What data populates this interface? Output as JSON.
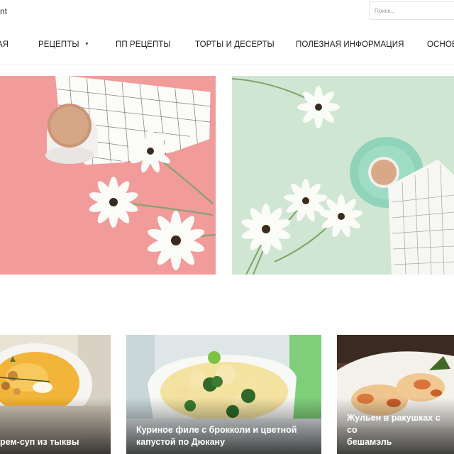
{
  "header": {
    "logo_text": "nt",
    "search_placeholder": "Поиск..."
  },
  "nav": {
    "items": [
      {
        "label": "АЯ"
      },
      {
        "label": "РЕЦЕПТЫ",
        "has_dropdown": true,
        "dropdown_icon": "chevron-down-icon"
      },
      {
        "label": "ПП РЕЦЕПТЫ"
      },
      {
        "label": "ТОРТЫ И ДЕСЕРТЫ"
      },
      {
        "label": "ПОЛЕЗНАЯ ИНФОРМАЦИЯ"
      },
      {
        "label": "ОСНОВ"
      }
    ]
  },
  "hero": {
    "left": {
      "image": "coffee-cup-and-daisies-on-pink",
      "bg_color": "#f19a9a"
    },
    "right": {
      "image": "coffee-cup-and-daisies-on-mint",
      "bg_color": "#cfe6d3"
    }
  },
  "cards": [
    {
      "title": "рем-суп из тыквы",
      "image": "pumpkin-cream-soup"
    },
    {
      "title": "Куриное филе с брокколи и цветной\nкапустой по Дюкану",
      "image": "chicken-broccoli-cauliflower-bake"
    },
    {
      "title": "Жульен в ракушках с со\nбешамэль",
      "image": "julienne-in-pasta-shells"
    }
  ]
}
